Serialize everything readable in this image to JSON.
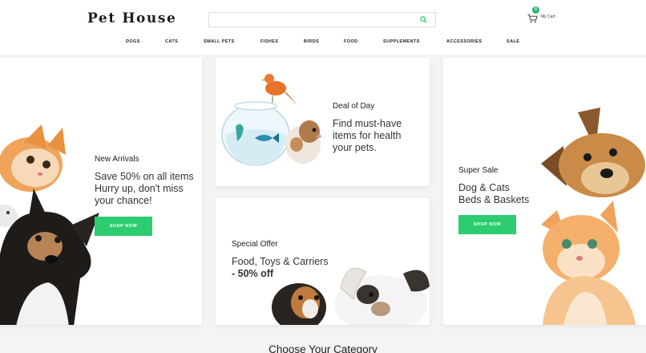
{
  "header": {
    "logo": "Pet House",
    "search_placeholder": "",
    "cart": {
      "count": "0",
      "label": "My Cart"
    }
  },
  "nav": [
    "DOGS",
    "CATS",
    "SMALL PETS",
    "FISHES",
    "BIRDS",
    "FOOD",
    "SUPPLEMENTS",
    "ACCESSORIES",
    "SALE"
  ],
  "banners": {
    "new_arrivals": {
      "eyebrow": "New Arrivals",
      "line1": "Save 50% on all items",
      "line2": "Hurry up, don't miss",
      "line3": "your chance!",
      "button": "SHOP NOW"
    },
    "deal_of_day": {
      "eyebrow": "Deal of Day",
      "line1": "Find must-have",
      "line2": "items for health",
      "line3": "your pets."
    },
    "special_offer": {
      "eyebrow": "Special Offer",
      "line1": "Food, Toys & Carriers",
      "line2": "- 50% off"
    },
    "super_sale": {
      "eyebrow": "Super Sale",
      "line1": "Dog & Cats",
      "line2": "Beds & Baskets",
      "button": "SHOP NOW"
    }
  },
  "section_title": "Choose Your Category",
  "colors": {
    "accent": "#2ecc71",
    "badge": "#2bb673",
    "background": "#f4f4f4"
  }
}
